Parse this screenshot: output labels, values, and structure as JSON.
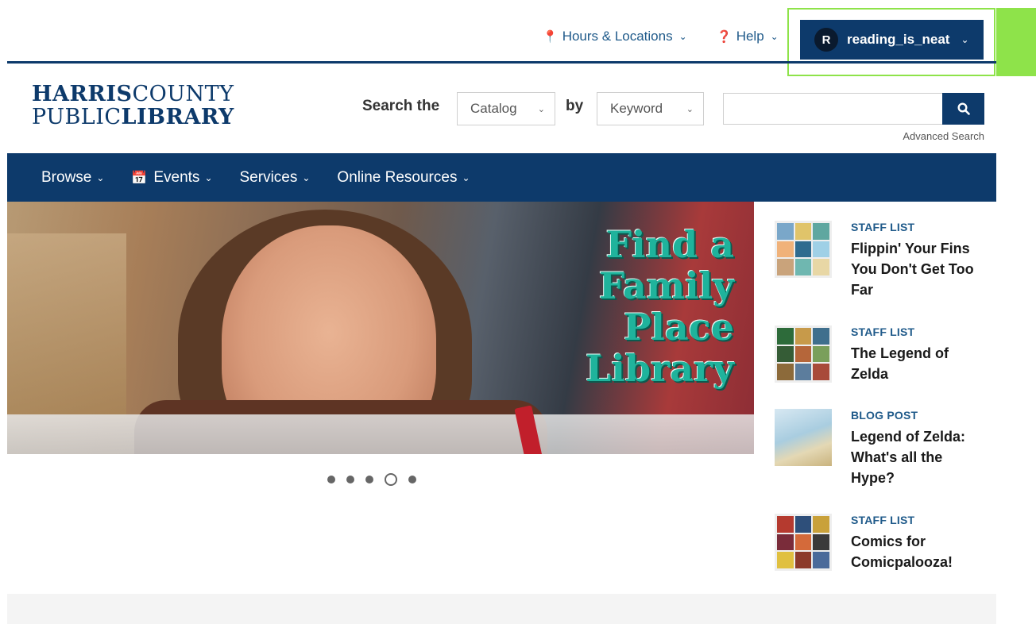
{
  "utility": {
    "hours_label": "Hours & Locations",
    "help_label": "Help",
    "user_initial": "R",
    "user_name": "reading_is_neat"
  },
  "logo": {
    "line1_bold": "HARRIS",
    "line1_regular": "COUNTY",
    "line2_regular": "PUBLIC",
    "line2_bold": "LIBRARY"
  },
  "search": {
    "search_the_label": "Search the",
    "scope_value": "Catalog",
    "by_label": "by",
    "field_value": "Keyword",
    "query_value": "",
    "advanced_label": "Advanced Search"
  },
  "nav": {
    "items": [
      {
        "label": "Browse"
      },
      {
        "label": "Events"
      },
      {
        "label": "Services"
      },
      {
        "label": "Online Resources"
      }
    ]
  },
  "hero": {
    "title_line1": "Find a Family",
    "title_line2": "Place Library",
    "carousel_active_index": 3,
    "carousel_count": 5
  },
  "sidebar": {
    "items": [
      {
        "kind": "STAFF LIST",
        "title": "Flippin' Your Fins You Don't Get Too Far"
      },
      {
        "kind": "STAFF LIST",
        "title": "The Legend of Zelda"
      },
      {
        "kind": "BLOG POST",
        "title": "Legend of Zelda: What's all the Hype?"
      },
      {
        "kind": "STAFF LIST",
        "title": "Comics for Comicpalooza!"
      }
    ]
  },
  "colors": {
    "brand_navy": "#0d3a6b",
    "link_blue": "#1f5a8a",
    "highlight_green": "#8ee34a",
    "hero_teal": "#1fb39c"
  }
}
